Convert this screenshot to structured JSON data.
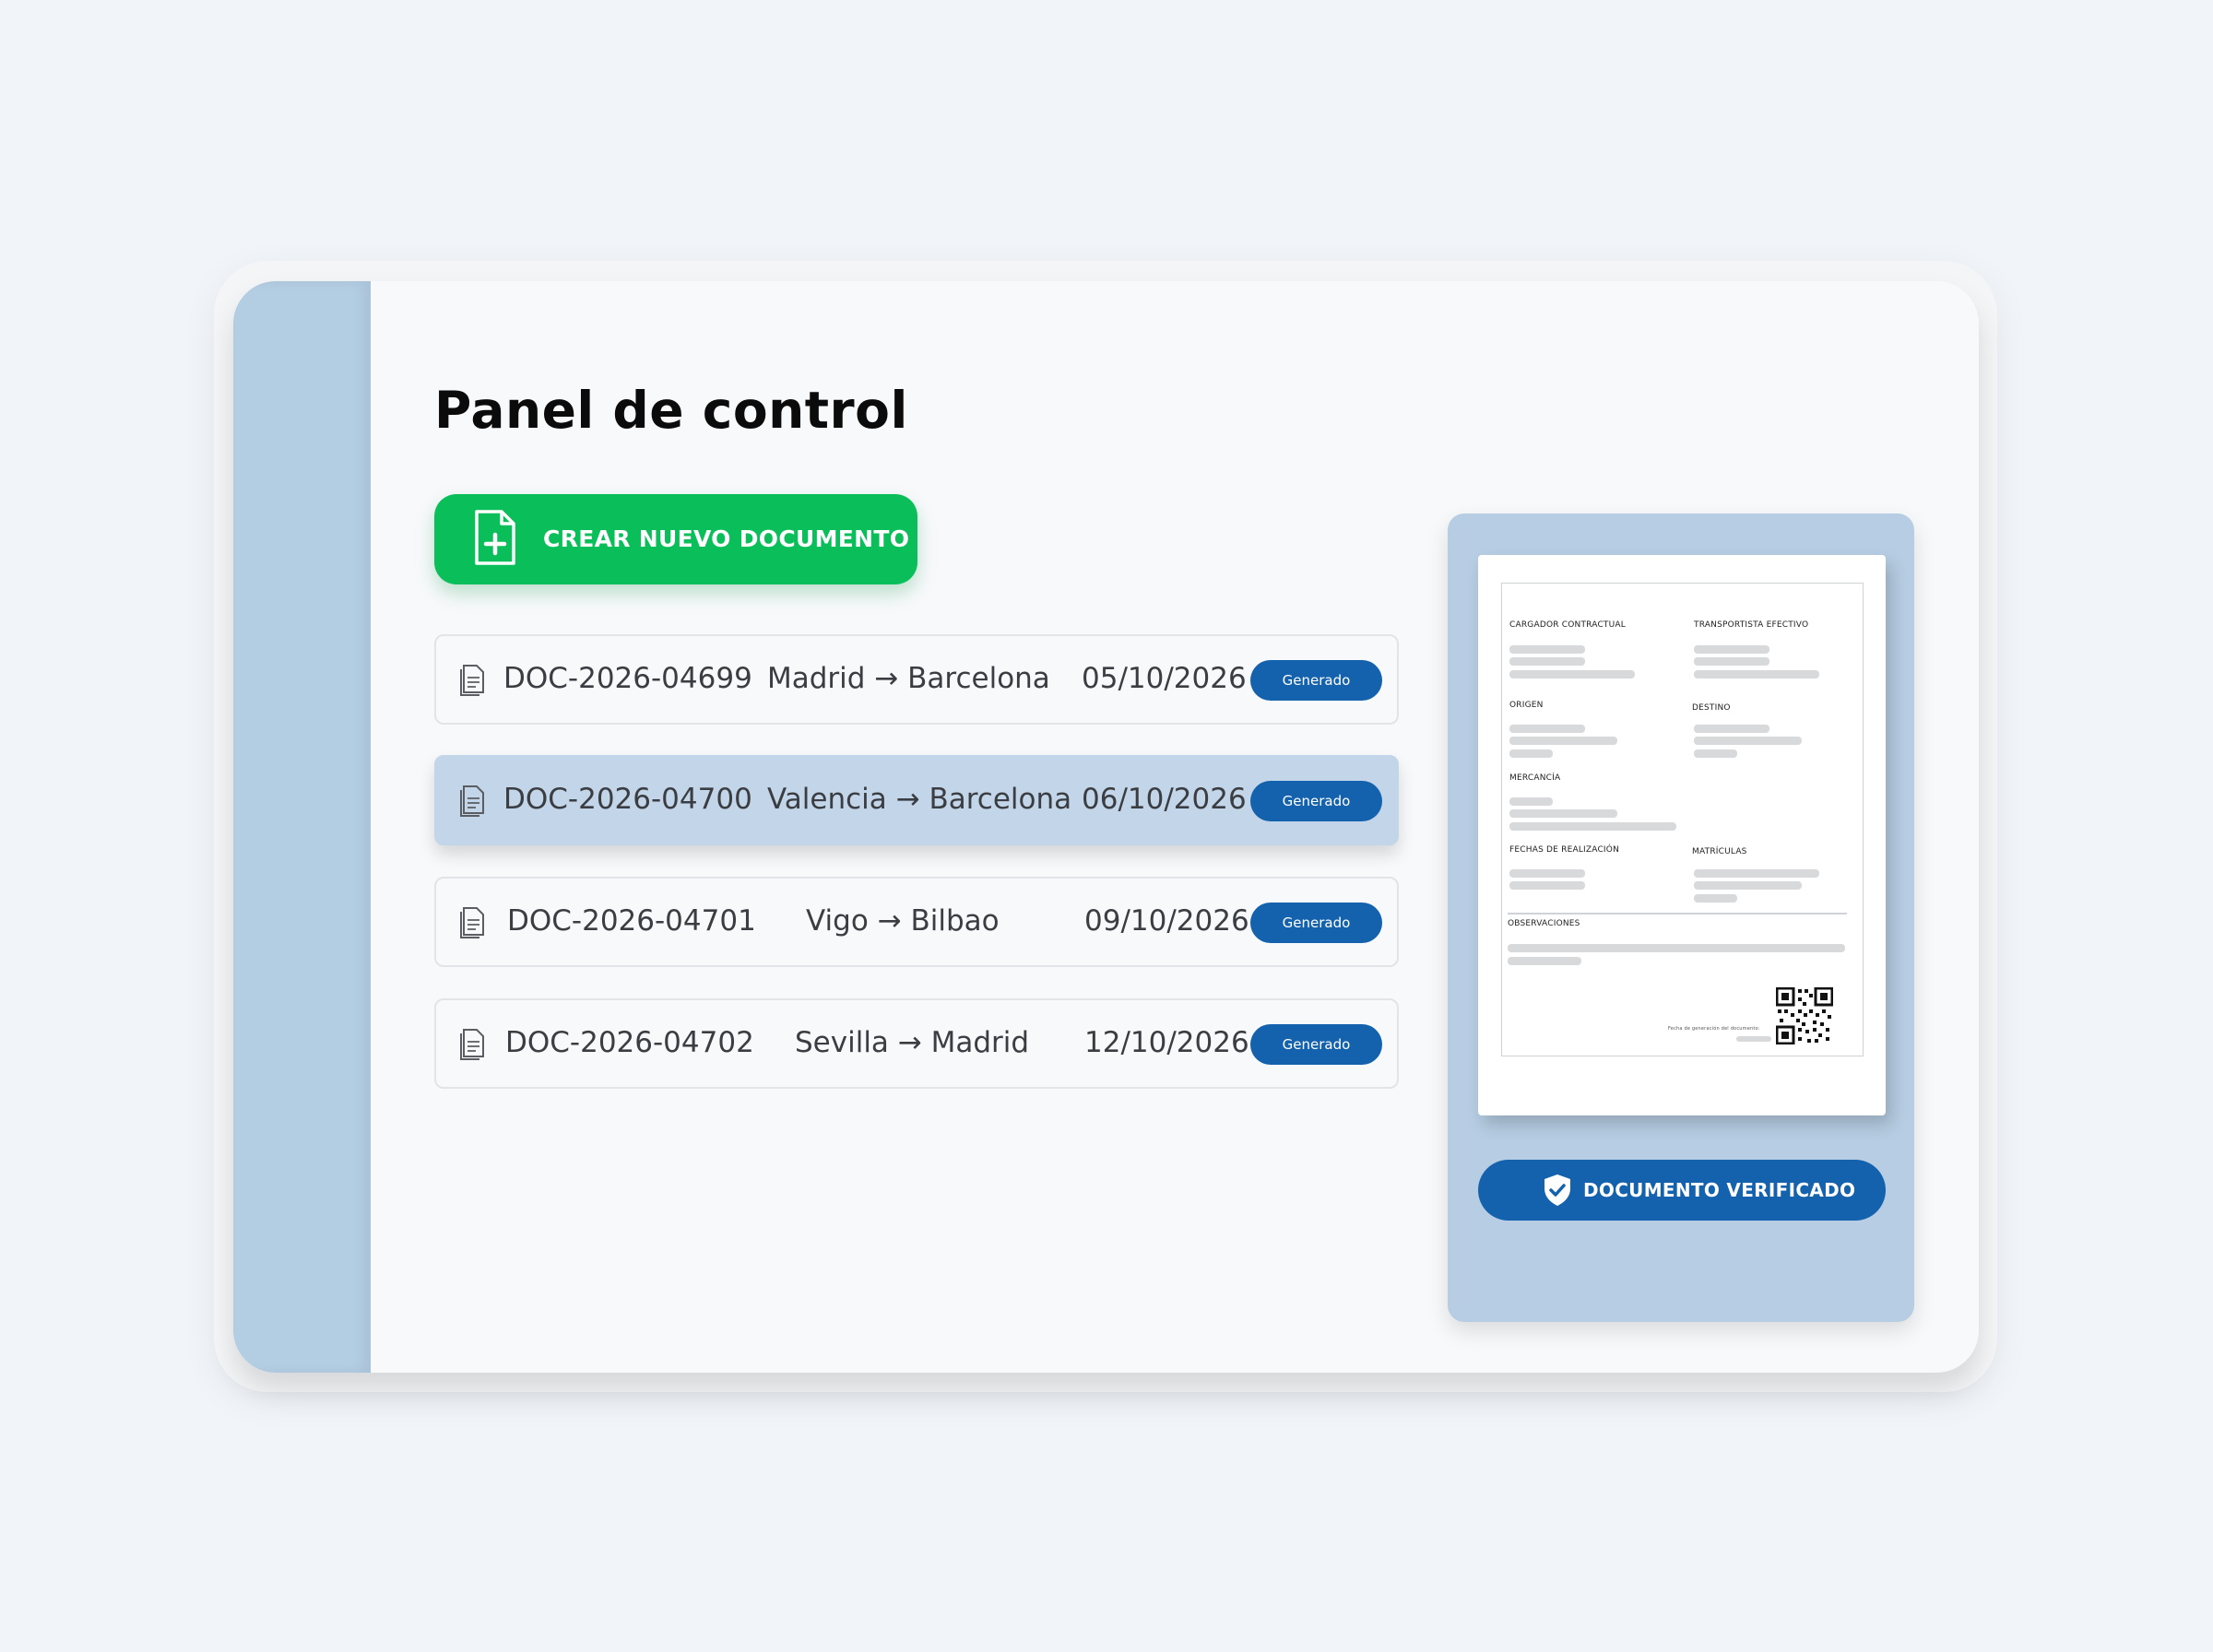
{
  "page": {
    "title": "Panel de control"
  },
  "create_button": {
    "label": "CREAR NUEVO DOCUMENTO",
    "icon": "file-plus-icon",
    "color": "#0abf5a"
  },
  "documents": [
    {
      "id": "DOC-2026-04699",
      "route": "Madrid → Barcelona",
      "date": "05/10/2026",
      "status": "Generado",
      "selected": false
    },
    {
      "id": "DOC-2026-04700",
      "route": "Valencia → Barcelona",
      "date": "06/10/2026",
      "status": "Generado",
      "selected": true
    },
    {
      "id": "DOC-2026-04701",
      "route": "Vigo → Bilbao",
      "date": "09/10/2026",
      "status": "Generado",
      "selected": false
    },
    {
      "id": "DOC-2026-04702",
      "route": "Sevilla → Madrid",
      "date": "12/10/2026",
      "status": "Generado",
      "selected": false
    }
  ],
  "preview": {
    "fields": {
      "cargador": "CARGADOR CONTRACTUAL",
      "transportista": "TRANSPORTISTA EFECTIVO",
      "origen": "ORIGEN",
      "destino": "DESTINO",
      "mercancia": "MERCANCÍA",
      "fechas": "FECHAS DE REALIZACIÓN",
      "matriculas": "MATRÍCULAS",
      "observaciones": "OBSERVACIONES",
      "generation_date": "Fecha de generación del documento:"
    },
    "verified_label": "DOCUMENTO VERIFICADO",
    "verified_icon": "shield-check-icon"
  },
  "colors": {
    "accent_blue": "#1462ad",
    "sidebar": "#b3cde3",
    "selected_row": "#c3d5e8",
    "green": "#0abf5a"
  }
}
